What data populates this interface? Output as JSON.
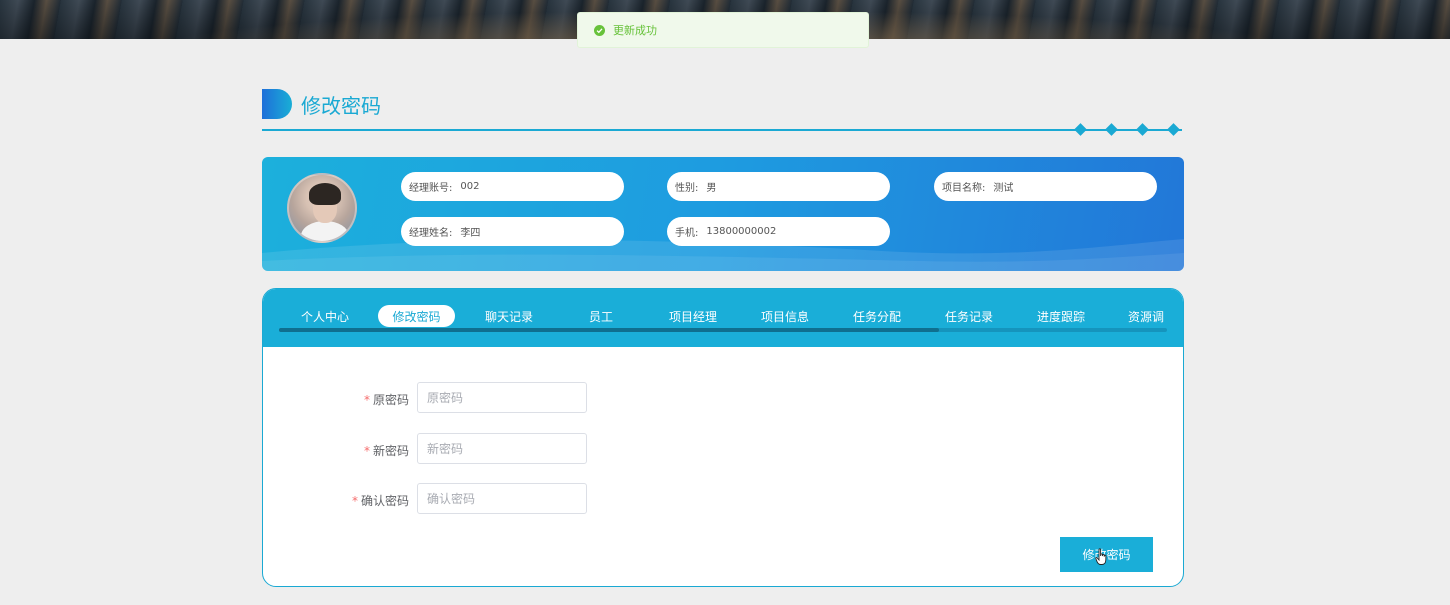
{
  "toast": {
    "message": "更新成功",
    "icon": "check-circle-icon",
    "color": "#67c23a"
  },
  "page": {
    "title": "修改密码",
    "accent": "#1aa9d3"
  },
  "profile": {
    "avatar": "user-avatar",
    "fields": [
      {
        "label": "经理账号:",
        "value": "002"
      },
      {
        "label": "性别:",
        "value": "男"
      },
      {
        "label": "项目名称:",
        "value": "测试"
      },
      {
        "label": "经理姓名:",
        "value": "李四"
      },
      {
        "label": "手机:",
        "value": "13800000002"
      }
    ]
  },
  "tabs": [
    {
      "label": "个人中心"
    },
    {
      "label": "修改密码",
      "active": true
    },
    {
      "label": "聊天记录"
    },
    {
      "label": "员工"
    },
    {
      "label": "项目经理"
    },
    {
      "label": "项目信息"
    },
    {
      "label": "任务分配"
    },
    {
      "label": "任务记录"
    },
    {
      "label": "进度跟踪"
    },
    {
      "label": "资源调"
    }
  ],
  "form": {
    "old_password": {
      "label": "原密码",
      "placeholder": "原密码",
      "required": true
    },
    "new_password": {
      "label": "新密码",
      "placeholder": "新密码",
      "required": true
    },
    "confirm_password": {
      "label": "确认密码",
      "placeholder": "确认密码",
      "required": true
    },
    "required_mark": "*",
    "submit_label": "修改密码"
  }
}
